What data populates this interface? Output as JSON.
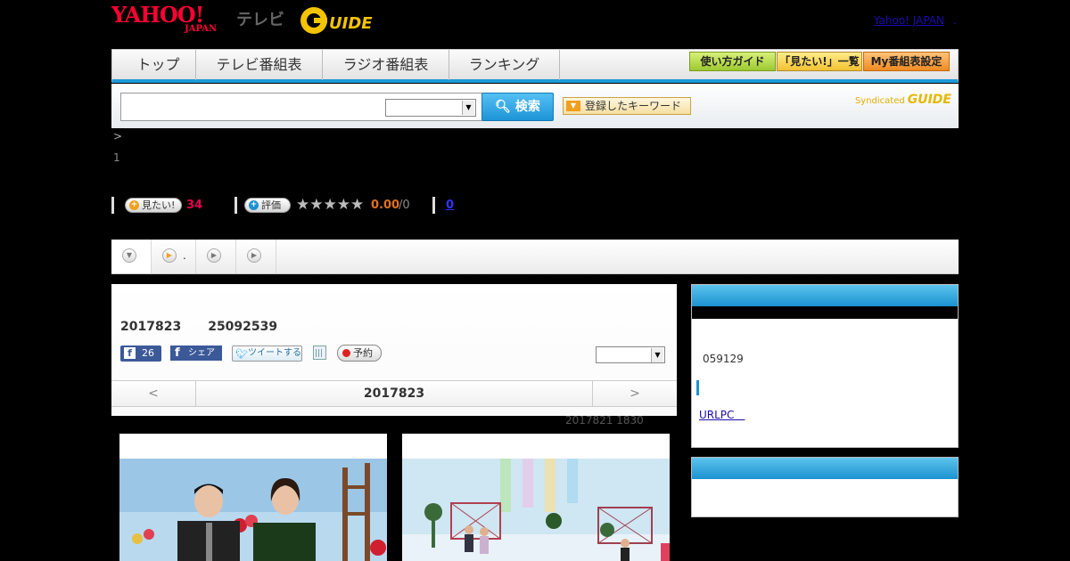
{
  "header": {
    "logo_yahoo": "YAHOO!",
    "logo_japan": "JAPAN",
    "logo_tv": "テレビ",
    "logo_gguide": "G-GUIDE",
    "yj_link": "Yahoo! JAPAN",
    "yj_dot": "."
  },
  "nav": {
    "tabs": [
      "トップ",
      "テレビ番組表",
      "ラジオ番組表",
      "ランキング"
    ],
    "right": [
      "使い方ガイド",
      "「見たい!」一覧",
      "My番組表設定"
    ]
  },
  "search": {
    "input_value": "",
    "button_label": "検索",
    "keyword_button": "登録したキーワード",
    "syndicated": "Syndicated",
    "syndicated_brand": "GUIDE"
  },
  "program": {
    "crumb": ">",
    "line1": "1",
    "want_label": "見たい!",
    "want_count": "34",
    "rate_label": "評価",
    "stars": "★★★★★",
    "rating": "0.00",
    "rating_total": "/0",
    "comments": "0"
  },
  "tabs": {
    "tab2_text": "."
  },
  "main": {
    "date": "2017823",
    "code": "25092539",
    "fb_count": "26",
    "fb_share": "シェア",
    "tweet": "ツイートする",
    "reserve": "予約",
    "prev": "<",
    "next": ">",
    "current_date": "2017823",
    "updated": "2017821  1830"
  },
  "sidebar": {
    "num": "059129",
    "link": "URLPC　"
  },
  "colors": {
    "accent_blue": "#1d9ad8",
    "yahoo_red": "#ff0033",
    "want_count_red": "#e5004f",
    "rating_orange": "#e07020"
  }
}
